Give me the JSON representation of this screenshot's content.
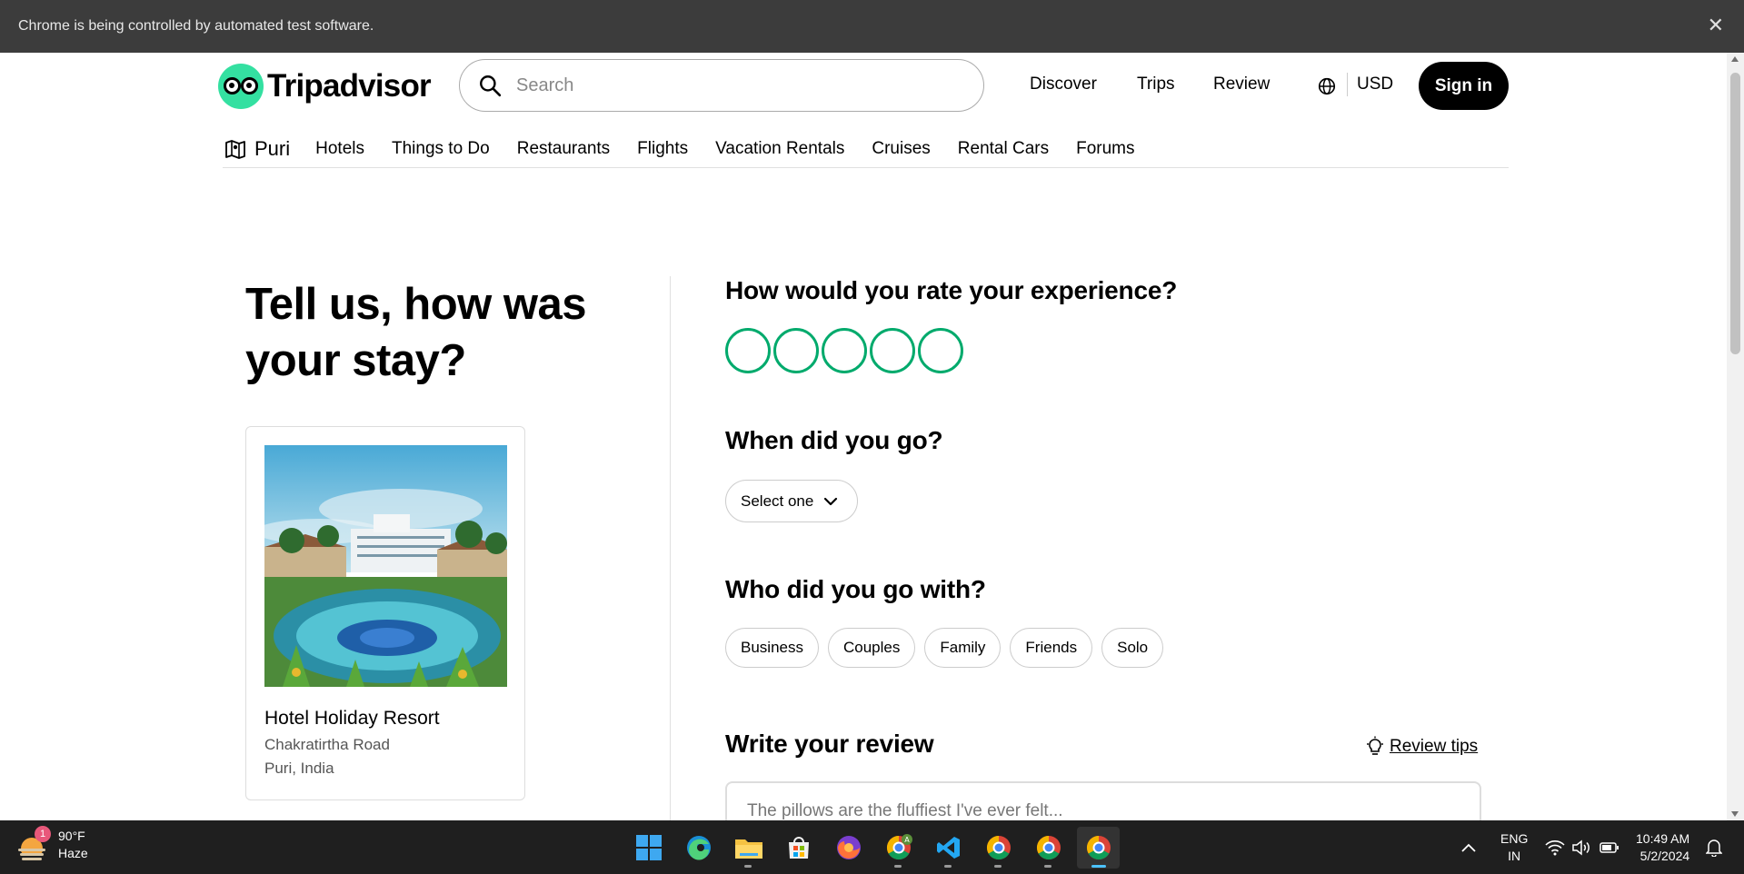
{
  "automation_bar": {
    "message": "Chrome is being controlled by automated test software.",
    "close_glyph": "✕"
  },
  "header": {
    "logo_text": "Tripadvisor",
    "search": {
      "placeholder": "Search",
      "value": ""
    },
    "nav": [
      "Discover",
      "Trips",
      "Review"
    ],
    "currency": "USD",
    "signin_label": "Sign in"
  },
  "sub_nav": {
    "location": "Puri",
    "items": [
      "Hotels",
      "Things to Do",
      "Restaurants",
      "Flights",
      "Vacation Rentals",
      "Cruises",
      "Rental Cars",
      "Forums"
    ]
  },
  "page": {
    "headline": "Tell us, how was your stay?",
    "hotel": {
      "name": "Hotel Holiday Resort",
      "address": "Chakratirtha Road",
      "city": "Puri, India"
    },
    "rating": {
      "question": "How would you rate your experience?",
      "max_bubbles": 5,
      "selected": 0
    },
    "when": {
      "question": "When did you go?",
      "select_label": "Select one"
    },
    "who": {
      "question": "Who did you go with?",
      "options": [
        "Business",
        "Couples",
        "Family",
        "Friends",
        "Solo"
      ]
    },
    "review": {
      "title": "Write your review",
      "tips_label": "Review tips",
      "placeholder": "The pillows are the fluffiest I've ever felt..."
    }
  },
  "taskbar": {
    "weather": {
      "temp": "90°F",
      "condition": "Haze",
      "badge": "1"
    },
    "language": {
      "line1": "ENG",
      "line2": "IN"
    },
    "time": "10:49 AM",
    "date": "5/2/2024"
  },
  "colors": {
    "brand_green": "#34e0a1",
    "bubble_green": "#00aa6c",
    "taskbar": "#1f1f1f",
    "automation_bar": "#3c3c3c"
  }
}
